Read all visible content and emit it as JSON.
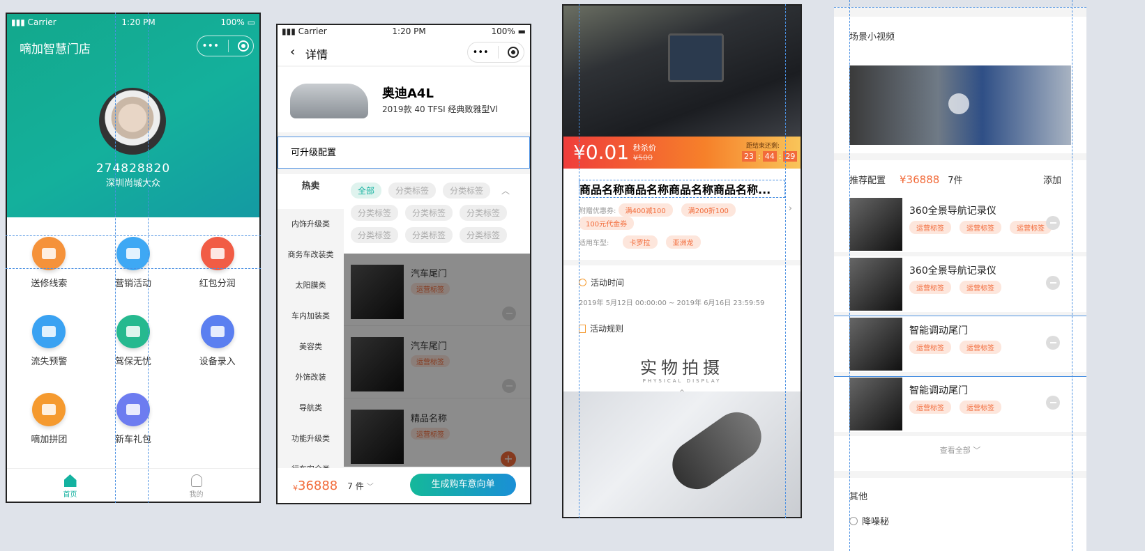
{
  "screen1": {
    "carrier": "Carrier",
    "time": "1:20 PM",
    "battery": "100%",
    "app_title": "嘀加智慧门店",
    "user_id": "274828820",
    "store_name": "深圳尚城大众",
    "menu": [
      {
        "label": "送修线索",
        "color": "#f5923a"
      },
      {
        "label": "营销活动",
        "color": "#3ea8f4"
      },
      {
        "label": "红包分润",
        "color": "#f15c45"
      },
      {
        "label": "流失预警",
        "color": "#3aa2f2"
      },
      {
        "label": "驾保无忧",
        "color": "#26b98f"
      },
      {
        "label": "设备录入",
        "color": "#5b7ff0"
      },
      {
        "label": "嘀加拼团",
        "color": "#f59a2f"
      },
      {
        "label": "新车礼包",
        "color": "#6d7cf0"
      }
    ],
    "tabbar": {
      "home": "首页",
      "mine": "我的"
    }
  },
  "screen2": {
    "carrier": "Carrier",
    "time": "1:20 PM",
    "battery": "100%",
    "nav_title": "详情",
    "car_name": "奥迪A4L",
    "car_model": "2019款 40 TFSI 经典致雅型Vl",
    "section_title": "可升级配置",
    "left_menu": [
      "热卖",
      "内饰升级类",
      "商务车改装类",
      "太阳膜类",
      "车内加装类",
      "美容类",
      "外饰改装",
      "导航类",
      "功能升级类",
      "行车安全类"
    ],
    "tag_all": "全部",
    "tags": [
      "分类标签",
      "分类标签",
      "分类标签",
      "分类标签",
      "分类标签",
      "分类标签",
      "分类标签",
      "分类标签"
    ],
    "products": [
      {
        "name": "汽车尾门",
        "tag": "运营标签"
      },
      {
        "name": "汽车尾门",
        "tag": "运营标签"
      },
      {
        "name": "精品名称",
        "tag": "运营标签"
      }
    ],
    "price": "36888",
    "currency": "¥",
    "count": "7 件",
    "submit": "生成购车意向单"
  },
  "screen3": {
    "price": "¥0.01",
    "flash_label": "秒杀价",
    "old_price": "¥500",
    "countdown_label": "距结束还剩:",
    "countdown": [
      "23",
      "44",
      "29"
    ],
    "product_title": "商品名称商品名称商品名称商品名称...",
    "coupon_label": "附赠优惠券:",
    "coupons": [
      "满400减100",
      "满200折100",
      "100元代金券"
    ],
    "car_label": "适用车型:",
    "cars": [
      "卡罗拉",
      "亚洲龙"
    ],
    "activity_time_label": "活动时间",
    "activity_time": "2019年 5月12日 00:00:00 ~ 2019年 6月16日 23:59:59",
    "rules_label": "活动规则",
    "photo_cn": "实物拍摄",
    "photo_en": "PHYSICAL DISPLAY"
  },
  "screen4": {
    "video_title": "场景小视频",
    "rec_label": "推荐配置",
    "rec_price": "¥36888",
    "rec_count": "7件",
    "add_label": "添加",
    "items": [
      {
        "name": "360全景导航记录仪",
        "tags": [
          "运营标签",
          "运营标签",
          "运营标签"
        ]
      },
      {
        "name": "360全景导航记录仪",
        "tags": [
          "运营标签",
          "运营标签"
        ]
      },
      {
        "name": "智能调动尾门",
        "tags": [
          "运营标签",
          "运营标签"
        ]
      },
      {
        "name": "智能调动尾门",
        "tags": [
          "运营标签",
          "运营标签"
        ]
      }
    ],
    "view_all": "查看全部",
    "other_label": "其他",
    "other_item": "降噪秘"
  },
  "colors": {
    "teal": "#0fb89a",
    "orange": "#f26b3a",
    "brand_teal": "#14b2a0"
  }
}
